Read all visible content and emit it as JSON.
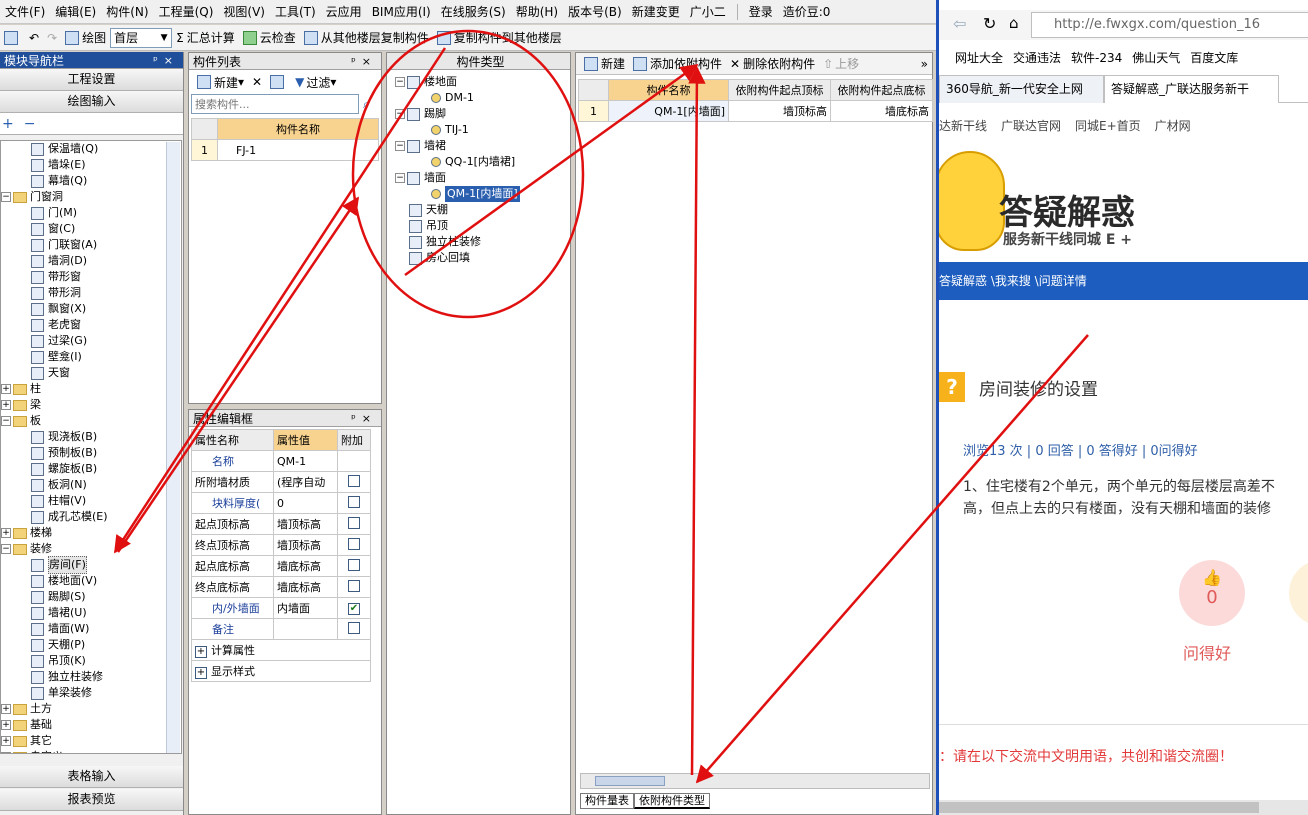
{
  "menu": [
    "文件(F)",
    "编辑(E)",
    "构件(N)",
    "工程量(Q)",
    "视图(V)",
    "工具(T)",
    "云应用",
    "BIM应用(I)",
    "在线服务(S)",
    "帮助(H)",
    "版本号(B)",
    "新建变更",
    "广小二",
    "登录",
    "造价豆:0"
  ],
  "toolbar": {
    "draw": "绘图",
    "floor": "首层",
    "sum_calc": "汇总计算",
    "cloud_check": "云检查",
    "copy_from": "从其他楼层复制构件",
    "copy_to": "复制构件到其他楼层"
  },
  "nav": {
    "title": "模块导航栏",
    "project_settings": "工程设置",
    "draw_input": "绘图输入",
    "table_input": "表格输入",
    "report_preview": "报表预览",
    "tree": [
      {
        "label": "保温墙(Q)",
        "type": "item"
      },
      {
        "label": "墙垛(E)",
        "type": "item"
      },
      {
        "label": "幕墙(Q)",
        "type": "item"
      },
      {
        "label": "门窗洞",
        "type": "folder-open"
      },
      {
        "label": "门(M)",
        "type": "item"
      },
      {
        "label": "窗(C)",
        "type": "item"
      },
      {
        "label": "门联窗(A)",
        "type": "item"
      },
      {
        "label": "墙洞(D)",
        "type": "item"
      },
      {
        "label": "带形窗",
        "type": "item"
      },
      {
        "label": "带形洞",
        "type": "item"
      },
      {
        "label": "飘窗(X)",
        "type": "item"
      },
      {
        "label": "老虎窗",
        "type": "item"
      },
      {
        "label": "过梁(G)",
        "type": "item"
      },
      {
        "label": "壁龛(I)",
        "type": "item"
      },
      {
        "label": "天窗",
        "type": "item"
      },
      {
        "label": "柱",
        "type": "folder"
      },
      {
        "label": "梁",
        "type": "folder"
      },
      {
        "label": "板",
        "type": "folder-open"
      },
      {
        "label": "现浇板(B)",
        "type": "item"
      },
      {
        "label": "预制板(B)",
        "type": "item"
      },
      {
        "label": "螺旋板(B)",
        "type": "item"
      },
      {
        "label": "板洞(N)",
        "type": "item"
      },
      {
        "label": "柱帽(V)",
        "type": "item"
      },
      {
        "label": "成孔芯模(E)",
        "type": "item"
      },
      {
        "label": "楼梯",
        "type": "folder"
      },
      {
        "label": "装修",
        "type": "folder-open"
      },
      {
        "label": "房间(F)",
        "type": "item-selected"
      },
      {
        "label": "楼地面(V)",
        "type": "item"
      },
      {
        "label": "踢脚(S)",
        "type": "item"
      },
      {
        "label": "墙裙(U)",
        "type": "item"
      },
      {
        "label": "墙面(W)",
        "type": "item"
      },
      {
        "label": "天棚(P)",
        "type": "item"
      },
      {
        "label": "吊顶(K)",
        "type": "item"
      },
      {
        "label": "独立柱装修",
        "type": "item"
      },
      {
        "label": "单梁装修",
        "type": "item"
      },
      {
        "label": "土方",
        "type": "folder"
      },
      {
        "label": "基础",
        "type": "folder"
      },
      {
        "label": "其它",
        "type": "folder"
      },
      {
        "label": "自定义",
        "type": "folder"
      }
    ]
  },
  "complist": {
    "title": "构件列表",
    "new": "新建",
    "filter": "过滤",
    "search_placeholder": "搜索构件...",
    "col": "构件名称",
    "rows": [
      {
        "num": "1",
        "name": "FJ-1"
      }
    ]
  },
  "props": {
    "title": "属性编辑框",
    "col_name": "属性名称",
    "col_value": "属性值",
    "col_add": "附加",
    "rows": [
      {
        "name": "名称",
        "value": "QM-1",
        "check": null,
        "blue": true
      },
      {
        "name": "所附墙材质",
        "value": "(程序自动",
        "check": false,
        "blue": false
      },
      {
        "name": "块料厚度(",
        "value": "0",
        "check": false,
        "blue": true
      },
      {
        "name": "起点顶标高",
        "value": "墙顶标高",
        "check": false,
        "blue": false
      },
      {
        "name": "终点顶标高",
        "value": "墙顶标高",
        "check": false,
        "blue": false
      },
      {
        "name": "起点底标高",
        "value": "墙底标高",
        "check": false,
        "blue": false
      },
      {
        "name": "终点底标高",
        "value": "墙底标高",
        "check": false,
        "blue": false
      },
      {
        "name": "内/外墙面",
        "value": "内墙面",
        "check": true,
        "blue": true
      },
      {
        "name": "备注",
        "value": "",
        "check": false,
        "blue": true
      }
    ],
    "calc_attrs": "计算属性",
    "display_style": "显示样式"
  },
  "typetree": {
    "title": "构件类型",
    "nodes": [
      {
        "label": "楼地面",
        "level": 0
      },
      {
        "label": "DM-1",
        "level": 1
      },
      {
        "label": "踢脚",
        "level": 0
      },
      {
        "label": "TIJ-1",
        "level": 1
      },
      {
        "label": "墙裙",
        "level": 0
      },
      {
        "label": "QQ-1[内墙裙]",
        "level": 1
      },
      {
        "label": "墙面",
        "level": 0
      },
      {
        "label": "QM-1[内墙面]",
        "level": 1,
        "selected": true
      },
      {
        "label": "天棚",
        "level": 0
      },
      {
        "label": "吊顶",
        "level": 0
      },
      {
        "label": "独立柱装修",
        "level": 0
      },
      {
        "label": "房心回填",
        "level": 0
      }
    ]
  },
  "rightpane": {
    "new": "新建",
    "add_dep": "添加依附构件",
    "del_dep": "删除依附构件",
    "move_up": "上移",
    "cols": [
      "构件名称",
      "依附构件起点顶标",
      "依附构件起点底标"
    ],
    "rows": [
      {
        "num": "1",
        "name": "QM-1[内墙面]",
        "top": "墙顶标高",
        "bottom": "墙底标高"
      }
    ],
    "tab1": "构件量表",
    "tab2": "依附构件类型"
  },
  "browser": {
    "url": "http://e.fwxgx.com/question_16",
    "bookmarks": [
      "网址大全",
      "交通违法",
      "软件-234",
      "佛山天气",
      "百度文库"
    ],
    "tabs": [
      "360导航_新一代安全上网",
      "答疑解惑_广联达服务新干"
    ],
    "sitenav": [
      "达新干线",
      "广联达官网",
      "同城E+首页",
      "广材网"
    ],
    "logo_title": "答疑解惑",
    "logo_sub": "服务新干线同城 E +",
    "breadcrumb": "答疑解惑 \\我来搜 \\问题详情",
    "question_title": "房间装修的设置",
    "stats": "浏览13 次 | 0 回答 | 0 答得好 | 0问得好",
    "body_line1": "1、住宅楼有2个单元，两个单元的每层楼层高差不",
    "body_line2": "高，但点上去的只有楼面，没有天棚和墙面的装修",
    "like_count": "0",
    "like_label": "问得好",
    "warn": "：请在以下交流中文明用语，共创和谐交流圈！"
  }
}
